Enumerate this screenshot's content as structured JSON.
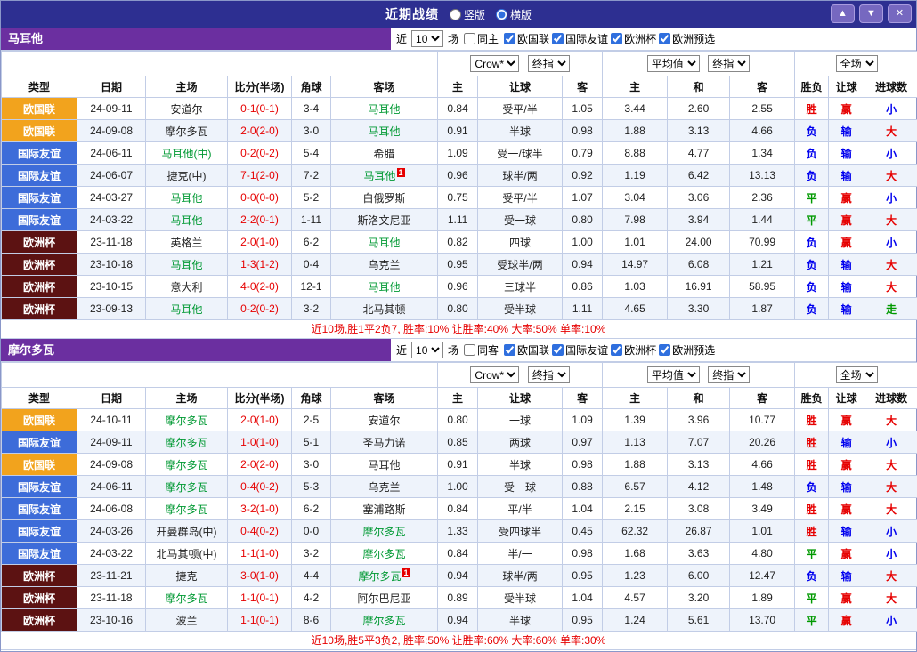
{
  "titlebar": {
    "title": "近期战绩",
    "radios": [
      {
        "label": "竖版",
        "selected": false
      },
      {
        "label": "横版",
        "selected": true
      }
    ],
    "buttons": [
      {
        "name": "scroll-up",
        "glyph": "▲"
      },
      {
        "name": "scroll-down",
        "glyph": "▼"
      },
      {
        "name": "close",
        "glyph": "✕"
      }
    ]
  },
  "table": {
    "headers": [
      "类型",
      "日期",
      "主场",
      "比分(半场)",
      "角球",
      "客场",
      "主",
      "让球",
      "客",
      "主",
      "和",
      "客",
      "胜负",
      "让球",
      "进球数"
    ],
    "select_groups": {
      "odds_source": "Crow*",
      "stage": "终指",
      "average": "平均值",
      "scope": "全场"
    }
  },
  "colors": {
    "titlebar_bg": "#2d2f91",
    "team_bar_purple": "#6b2fa0",
    "league_orange": "#f2a31d",
    "league_blue": "#3d6cd9",
    "league_dark": "#5c1212",
    "focal_green": "#009933",
    "win_red": "#e60000",
    "loss_blue": "#0000ee",
    "draw_green": "#009900"
  },
  "sections": [
    {
      "team": "马耳他",
      "filter": {
        "near": "近",
        "count": "10",
        "games": "场",
        "same_label": "同主",
        "leagues": [
          "欧国联",
          "国际友谊",
          "欧洲杯",
          "欧洲预选"
        ]
      },
      "rows": [
        {
          "type": "欧国联",
          "date": "24-09-11",
          "home": "安道尔",
          "home_focal": false,
          "score": "0-1(0-1)",
          "corner": "3-4",
          "away": "马耳他",
          "away_focal": true,
          "odds": [
            "0.84",
            "受平/半",
            "1.05",
            "3.44",
            "2.60",
            "2.55"
          ],
          "results": [
            "胜",
            "赢",
            "小"
          ]
        },
        {
          "type": "欧国联",
          "date": "24-09-08",
          "home": "摩尔多瓦",
          "home_focal": false,
          "score": "2-0(2-0)",
          "corner": "3-0",
          "away": "马耳他",
          "away_focal": true,
          "odds": [
            "0.91",
            "半球",
            "0.98",
            "1.88",
            "3.13",
            "4.66"
          ],
          "results": [
            "负",
            "输",
            "大"
          ]
        },
        {
          "type": "国际友谊",
          "date": "24-06-11",
          "home": "马耳他(中)",
          "home_focal": true,
          "score": "0-2(0-2)",
          "corner": "5-4",
          "away": "希腊",
          "away_focal": false,
          "odds": [
            "1.09",
            "受一/球半",
            "0.79",
            "8.88",
            "4.77",
            "1.34"
          ],
          "results": [
            "负",
            "输",
            "小"
          ]
        },
        {
          "type": "国际友谊",
          "date": "24-06-07",
          "home": "捷克(中)",
          "home_focal": false,
          "score": "7-1(2-0)",
          "corner": "7-2",
          "away": "马耳他",
          "away_focal": true,
          "away_card": "1",
          "odds": [
            "0.96",
            "球半/两",
            "0.92",
            "1.19",
            "6.42",
            "13.13"
          ],
          "results": [
            "负",
            "输",
            "大"
          ]
        },
        {
          "type": "国际友谊",
          "date": "24-03-27",
          "home": "马耳他",
          "home_focal": true,
          "score": "0-0(0-0)",
          "corner": "5-2",
          "away": "白俄罗斯",
          "away_focal": false,
          "odds": [
            "0.75",
            "受平/半",
            "1.07",
            "3.04",
            "3.06",
            "2.36"
          ],
          "results": [
            "平",
            "赢",
            "小"
          ]
        },
        {
          "type": "国际友谊",
          "date": "24-03-22",
          "home": "马耳他",
          "home_focal": true,
          "score": "2-2(0-1)",
          "corner": "1-11",
          "away": "斯洛文尼亚",
          "away_focal": false,
          "odds": [
            "1.11",
            "受一球",
            "0.80",
            "7.98",
            "3.94",
            "1.44"
          ],
          "results": [
            "平",
            "赢",
            "大"
          ]
        },
        {
          "type": "欧洲杯",
          "date": "23-11-18",
          "home": "英格兰",
          "home_focal": false,
          "score": "2-0(1-0)",
          "corner": "6-2",
          "away": "马耳他",
          "away_focal": true,
          "odds": [
            "0.82",
            "四球",
            "1.00",
            "1.01",
            "24.00",
            "70.99"
          ],
          "results": [
            "负",
            "赢",
            "小"
          ]
        },
        {
          "type": "欧洲杯",
          "date": "23-10-18",
          "home": "马耳他",
          "home_focal": true,
          "score": "1-3(1-2)",
          "corner": "0-4",
          "away": "乌克兰",
          "away_focal": false,
          "odds": [
            "0.95",
            "受球半/两",
            "0.94",
            "14.97",
            "6.08",
            "1.21"
          ],
          "results": [
            "负",
            "输",
            "大"
          ]
        },
        {
          "type": "欧洲杯",
          "date": "23-10-15",
          "home": "意大利",
          "home_focal": false,
          "score": "4-0(2-0)",
          "corner": "12-1",
          "away": "马耳他",
          "away_focal": true,
          "odds": [
            "0.96",
            "三球半",
            "0.86",
            "1.03",
            "16.91",
            "58.95"
          ],
          "results": [
            "负",
            "输",
            "大"
          ]
        },
        {
          "type": "欧洲杯",
          "date": "23-09-13",
          "home": "马耳他",
          "home_focal": true,
          "score": "0-2(0-2)",
          "corner": "3-2",
          "away": "北马其顿",
          "away_focal": false,
          "odds": [
            "0.80",
            "受半球",
            "1.11",
            "4.65",
            "3.30",
            "1.87"
          ],
          "results": [
            "负",
            "输",
            "走"
          ]
        }
      ],
      "summary": "近10场,胜1平2负7, 胜率:10% 让胜率:40% 大率:50% 单率:10%"
    },
    {
      "team": "摩尔多瓦",
      "filter": {
        "near": "近",
        "count": "10",
        "games": "场",
        "same_label": "同客",
        "leagues": [
          "欧国联",
          "国际友谊",
          "欧洲杯",
          "欧洲预选"
        ]
      },
      "rows": [
        {
          "type": "欧国联",
          "date": "24-10-11",
          "home": "摩尔多瓦",
          "home_focal": true,
          "score": "2-0(1-0)",
          "corner": "2-5",
          "away": "安道尔",
          "away_focal": false,
          "odds": [
            "0.80",
            "一球",
            "1.09",
            "1.39",
            "3.96",
            "10.77"
          ],
          "results": [
            "胜",
            "赢",
            "大"
          ]
        },
        {
          "type": "国际友谊",
          "date": "24-09-11",
          "home": "摩尔多瓦",
          "home_focal": true,
          "score": "1-0(1-0)",
          "corner": "5-1",
          "away": "圣马力诺",
          "away_focal": false,
          "odds": [
            "0.85",
            "两球",
            "0.97",
            "1.13",
            "7.07",
            "20.26"
          ],
          "results": [
            "胜",
            "输",
            "小"
          ]
        },
        {
          "type": "欧国联",
          "date": "24-09-08",
          "home": "摩尔多瓦",
          "home_focal": true,
          "score": "2-0(2-0)",
          "corner": "3-0",
          "away": "马耳他",
          "away_focal": false,
          "odds": [
            "0.91",
            "半球",
            "0.98",
            "1.88",
            "3.13",
            "4.66"
          ],
          "results": [
            "胜",
            "赢",
            "大"
          ]
        },
        {
          "type": "国际友谊",
          "date": "24-06-11",
          "home": "摩尔多瓦",
          "home_focal": true,
          "score": "0-4(0-2)",
          "corner": "5-3",
          "away": "乌克兰",
          "away_focal": false,
          "odds": [
            "1.00",
            "受一球",
            "0.88",
            "6.57",
            "4.12",
            "1.48"
          ],
          "results": [
            "负",
            "输",
            "大"
          ]
        },
        {
          "type": "国际友谊",
          "date": "24-06-08",
          "home": "摩尔多瓦",
          "home_focal": true,
          "score": "3-2(1-0)",
          "corner": "6-2",
          "away": "塞浦路斯",
          "away_focal": false,
          "odds": [
            "0.84",
            "平/半",
            "1.04",
            "2.15",
            "3.08",
            "3.49"
          ],
          "results": [
            "胜",
            "赢",
            "大"
          ]
        },
        {
          "type": "国际友谊",
          "date": "24-03-26",
          "home": "开曼群岛(中)",
          "home_focal": false,
          "score": "0-4(0-2)",
          "corner": "0-0",
          "away": "摩尔多瓦",
          "away_focal": true,
          "odds": [
            "1.33",
            "受四球半",
            "0.45",
            "62.32",
            "26.87",
            "1.01"
          ],
          "results": [
            "胜",
            "输",
            "小"
          ]
        },
        {
          "type": "国际友谊",
          "date": "24-03-22",
          "home": "北马其顿(中)",
          "home_focal": false,
          "score": "1-1(1-0)",
          "corner": "3-2",
          "away": "摩尔多瓦",
          "away_focal": true,
          "odds": [
            "0.84",
            "半/一",
            "0.98",
            "1.68",
            "3.63",
            "4.80"
          ],
          "results": [
            "平",
            "赢",
            "小"
          ]
        },
        {
          "type": "欧洲杯",
          "date": "23-11-21",
          "home": "捷克",
          "home_focal": false,
          "score": "3-0(1-0)",
          "corner": "4-4",
          "away": "摩尔多瓦",
          "away_focal": true,
          "away_card": "1",
          "odds": [
            "0.94",
            "球半/两",
            "0.95",
            "1.23",
            "6.00",
            "12.47"
          ],
          "results": [
            "负",
            "输",
            "大"
          ]
        },
        {
          "type": "欧洲杯",
          "date": "23-11-18",
          "home": "摩尔多瓦",
          "home_focal": true,
          "score": "1-1(0-1)",
          "corner": "4-2",
          "away": "阿尔巴尼亚",
          "away_focal": false,
          "odds": [
            "0.89",
            "受半球",
            "1.04",
            "4.57",
            "3.20",
            "1.89"
          ],
          "results": [
            "平",
            "赢",
            "大"
          ]
        },
        {
          "type": "欧洲杯",
          "date": "23-10-16",
          "home": "波兰",
          "home_focal": false,
          "score": "1-1(0-1)",
          "corner": "8-6",
          "away": "摩尔多瓦",
          "away_focal": true,
          "odds": [
            "0.94",
            "半球",
            "0.95",
            "1.24",
            "5.61",
            "13.70"
          ],
          "results": [
            "平",
            "赢",
            "小"
          ]
        }
      ],
      "summary": "近10场,胜5平3负2, 胜率:50% 让胜率:60% 大率:60% 单率:30%"
    }
  ]
}
